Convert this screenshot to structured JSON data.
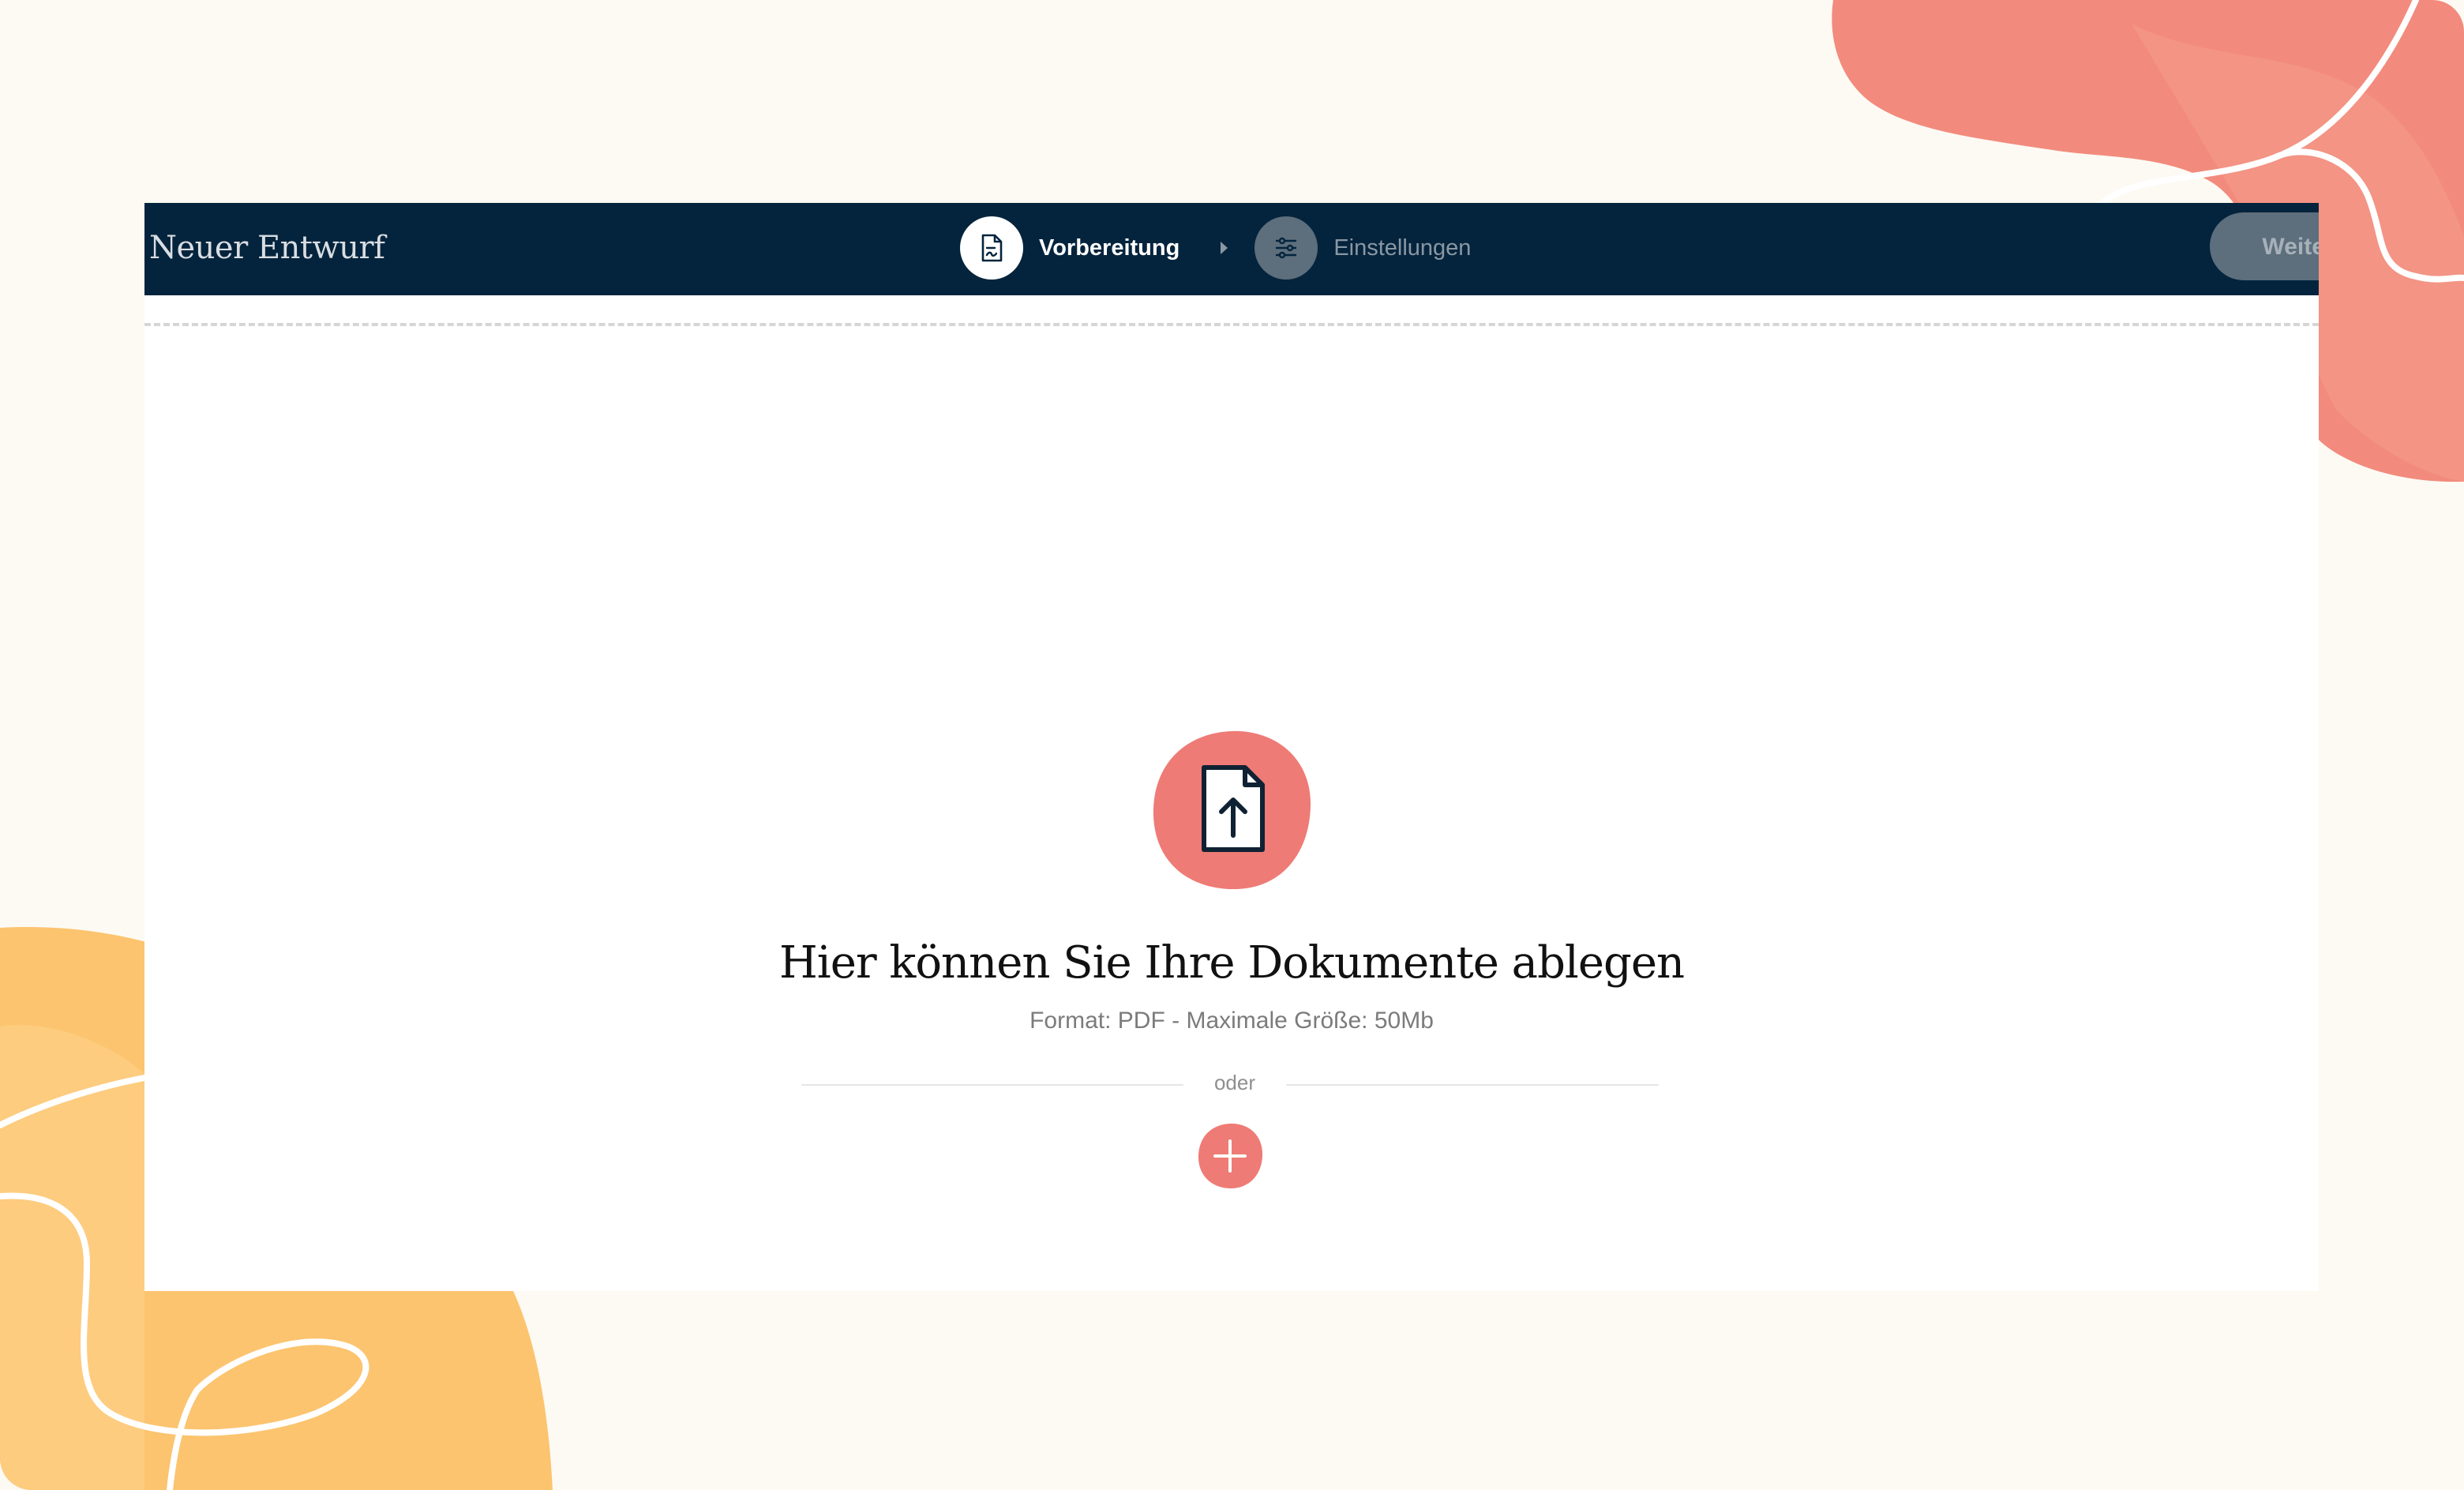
{
  "app": {
    "draft_title": "Neuer Entwurf"
  },
  "stepper": {
    "steps": [
      {
        "label": "Vorbereitung",
        "state": "active",
        "icon": "document-edit-icon"
      },
      {
        "label": "Einstellungen",
        "state": "inactive",
        "icon": "sliders-icon"
      }
    ],
    "separator_icon": "caret-right-icon"
  },
  "toolbar": {
    "next_label": "Weiter"
  },
  "drop_zone": {
    "icon": "file-upload-icon",
    "title": "Hier können Sie Ihre Dokumente ablegen",
    "subtitle": "Format: PDF - Maximale Größe: 50Mb",
    "or_label": "oder",
    "add_icon": "plus-icon"
  },
  "colors": {
    "topbar": "#04243d",
    "accent_coral": "#ee7b75",
    "accent_yellow": "#fdc06b",
    "background": "#fdfaf3"
  }
}
